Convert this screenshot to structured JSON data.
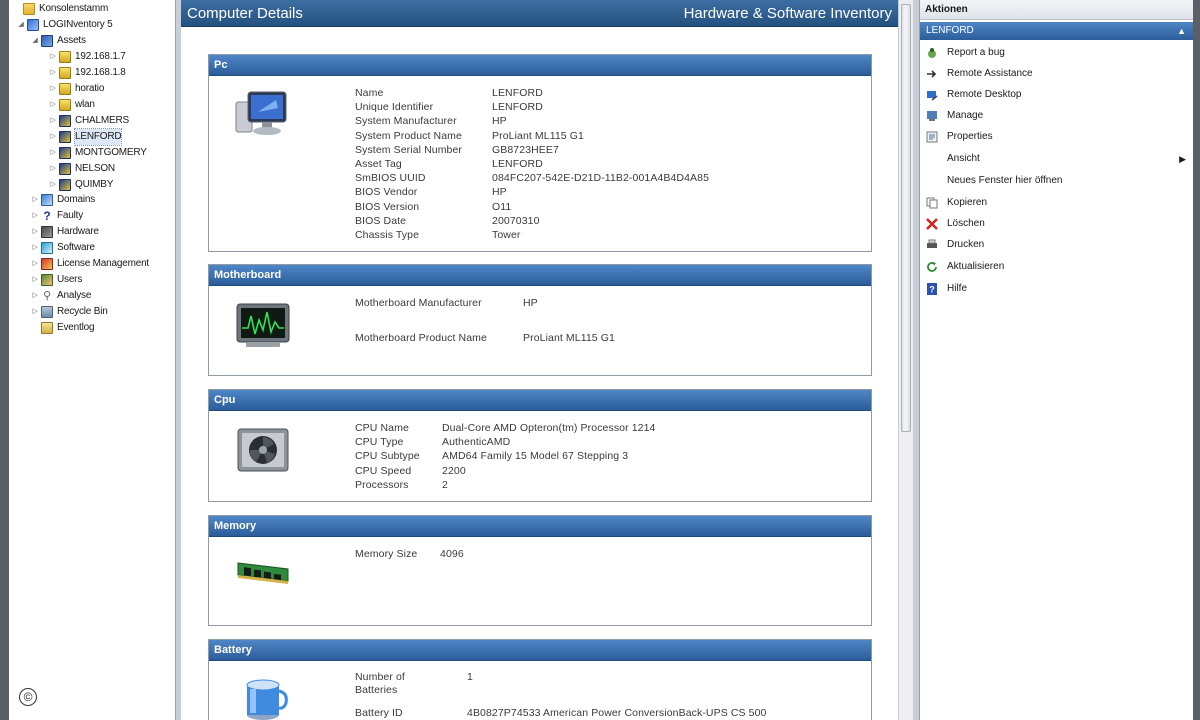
{
  "tree": {
    "root": "Konsolenstamm",
    "app": "LOGINventory 5",
    "assets": "Assets",
    "asset_children": [
      "192.168.1.7",
      "192.168.1.8",
      "horatio",
      "wlan",
      "CHALMERS",
      "LENFORD",
      "MONTGOMERY",
      "NELSON",
      "QUIMBY"
    ],
    "groups": [
      "Domains",
      "Faulty",
      "Hardware",
      "Software",
      "License Management",
      "Users",
      "Analyse",
      "Recycle Bin",
      "Eventlog"
    ]
  },
  "content": {
    "title": "Computer Details",
    "subtitle": "Hardware & Software Inventory",
    "sections": {
      "pc": {
        "title": "Pc",
        "rows": [
          {
            "k": "Name",
            "v": "LENFORD"
          },
          {
            "k": "Unique Identifier",
            "v": "LENFORD"
          },
          {
            "k": "System Manufacturer",
            "v": "HP"
          },
          {
            "k": "System Product Name",
            "v": "ProLiant ML115 G1"
          },
          {
            "k": "System Serial Number",
            "v": "GB8723HEE7"
          },
          {
            "k": "Asset Tag",
            "v": "LENFORD"
          },
          {
            "k": "SmBIOS UUID",
            "v": "084FC207-542E-D21D-11B2-001A4B4D4A85"
          },
          {
            "k": "BIOS Vendor",
            "v": "HP"
          },
          {
            "k": "BIOS Version",
            "v": "O11"
          },
          {
            "k": "BIOS Date",
            "v": "20070310"
          },
          {
            "k": "Chassis Type",
            "v": "Tower"
          }
        ]
      },
      "motherboard": {
        "title": "Motherboard",
        "rows": [
          {
            "k": "Motherboard Manufacturer",
            "v": "HP"
          },
          {
            "k": "Motherboard Product Name",
            "v": "ProLiant ML115 G1"
          }
        ]
      },
      "cpu": {
        "title": "Cpu",
        "rows": [
          {
            "k": "CPU Name",
            "v": "Dual-Core AMD Opteron(tm) Processor 1214"
          },
          {
            "k": "CPU Type",
            "v": "AuthenticAMD"
          },
          {
            "k": "CPU Subtype",
            "v": "AMD64 Family 15 Model 67 Stepping 3"
          },
          {
            "k": "CPU Speed",
            "v": "2200"
          },
          {
            "k": "Processors",
            "v": "2"
          }
        ]
      },
      "memory": {
        "title": "Memory",
        "rows": [
          {
            "k": "Memory Size",
            "v": "4096"
          }
        ]
      },
      "battery": {
        "title": "Battery",
        "rows": [
          {
            "k": "Number of Batteries",
            "v": "1"
          },
          {
            "k": "Battery ID",
            "v": "4B0827P74533 American Power ConversionBack-UPS CS 500"
          }
        ]
      }
    }
  },
  "actions": {
    "title": "Aktionen",
    "selected": "LENFORD",
    "items": [
      {
        "label": "Report a bug",
        "icon": "bug-icon"
      },
      {
        "label": "Remote Assistance",
        "icon": "remote-assistance-icon"
      },
      {
        "label": "Remote Desktop",
        "icon": "remote-desktop-icon"
      },
      {
        "label": "Manage",
        "icon": "manage-icon"
      },
      {
        "label": "Properties",
        "icon": "properties-icon"
      },
      {
        "label": "Ansicht",
        "icon": ""
      },
      {
        "label": "Neues Fenster hier öffnen",
        "icon": ""
      },
      {
        "label": "Kopieren",
        "icon": "copy-icon"
      },
      {
        "label": "Löschen",
        "icon": "delete-icon"
      },
      {
        "label": "Drucken",
        "icon": "print-icon"
      },
      {
        "label": "Aktualisieren",
        "icon": "refresh-icon"
      },
      {
        "label": "Hilfe",
        "icon": "help-icon"
      }
    ]
  },
  "colors": {
    "header_blue": "#2b5d9a",
    "accent": "#4f86c6"
  }
}
